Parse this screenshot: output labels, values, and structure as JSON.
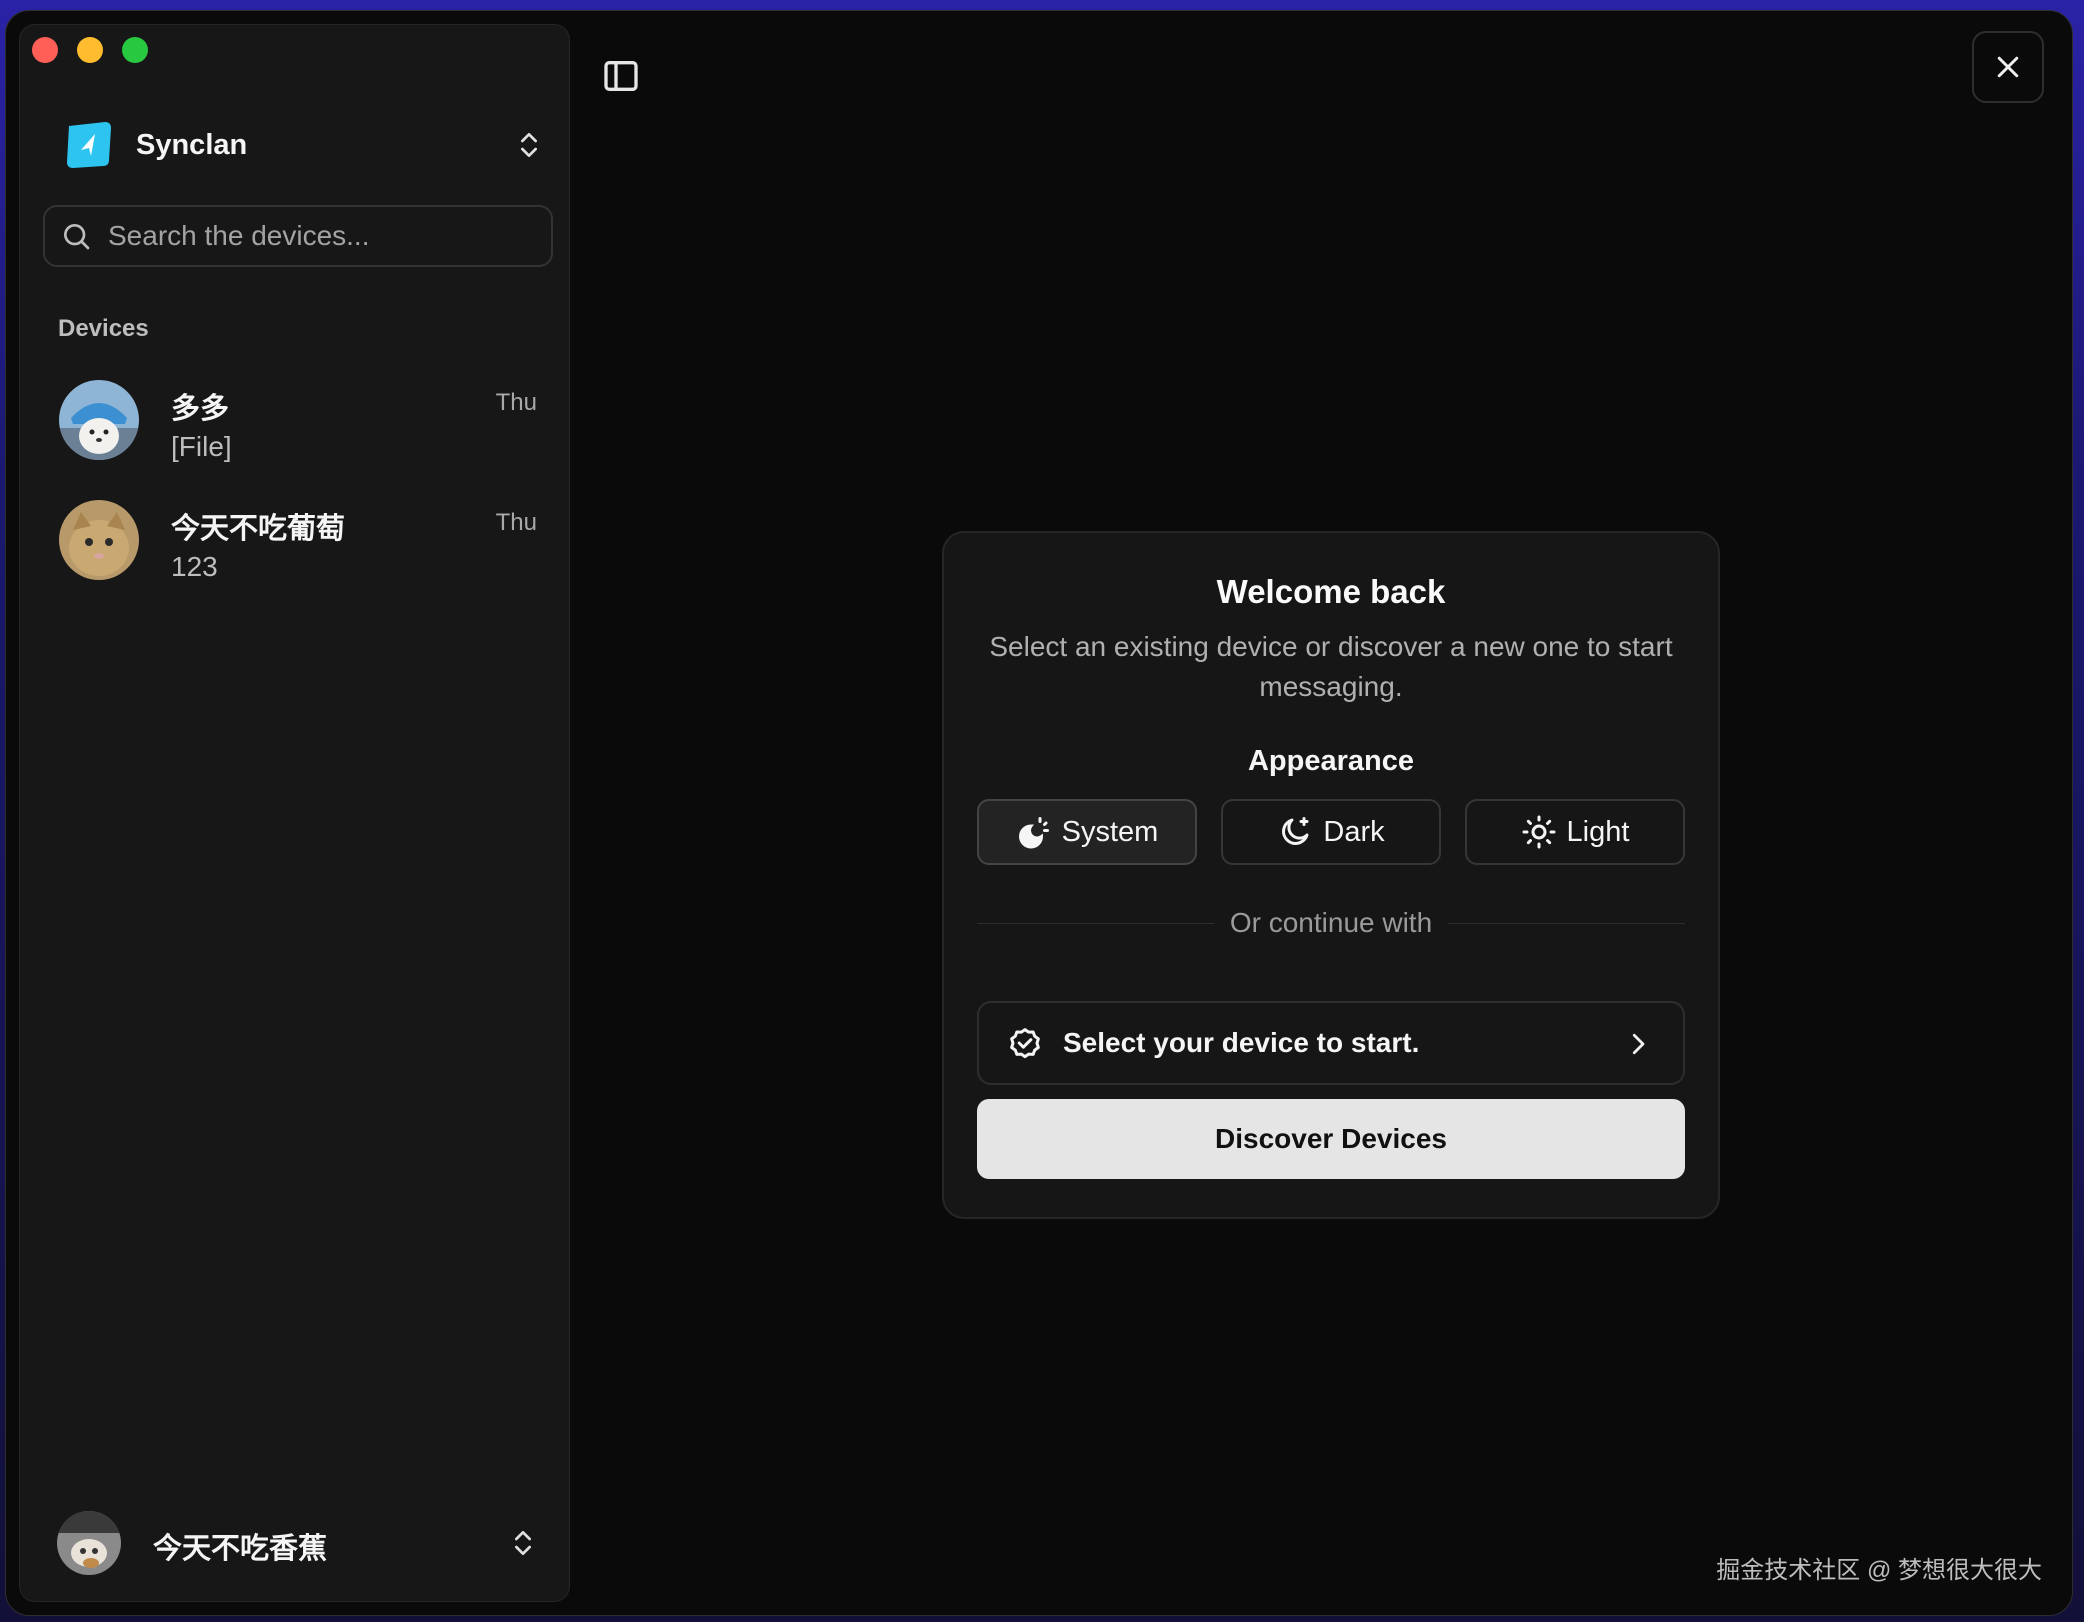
{
  "app": {
    "name": "Synclan"
  },
  "search": {
    "placeholder": "Search the devices..."
  },
  "sidebar": {
    "section_label": "Devices",
    "devices": [
      {
        "name": "多多",
        "preview": "[File]",
        "time": "Thu",
        "avatar": "dog-photo"
      },
      {
        "name": "今天不吃葡萄",
        "preview": "123",
        "time": "Thu",
        "avatar": "cat-photo"
      }
    ],
    "current_user": {
      "name": "今天不吃香蕉",
      "avatar": "user-photo"
    }
  },
  "welcome": {
    "title": "Welcome back",
    "subtitle": "Select an existing device or discover a new one to start messaging.",
    "appearance_label": "Appearance",
    "themes": [
      {
        "label": "System",
        "icon": "system-theme-icon",
        "active": true
      },
      {
        "label": "Dark",
        "icon": "moon-icon",
        "active": false
      },
      {
        "label": "Light",
        "icon": "sun-icon",
        "active": false
      }
    ],
    "divider_text": "Or continue with",
    "select_device_label": "Select your device to start.",
    "discover_button": "Discover Devices"
  },
  "watermark": "掘金技术社区 @ 梦想很大很大",
  "colors": {
    "background": "#0a0a0a",
    "sidebar": "#171717",
    "card": "#161616",
    "primary_button": "#e5e5e5",
    "accent_logo": "#2ec4f0"
  }
}
